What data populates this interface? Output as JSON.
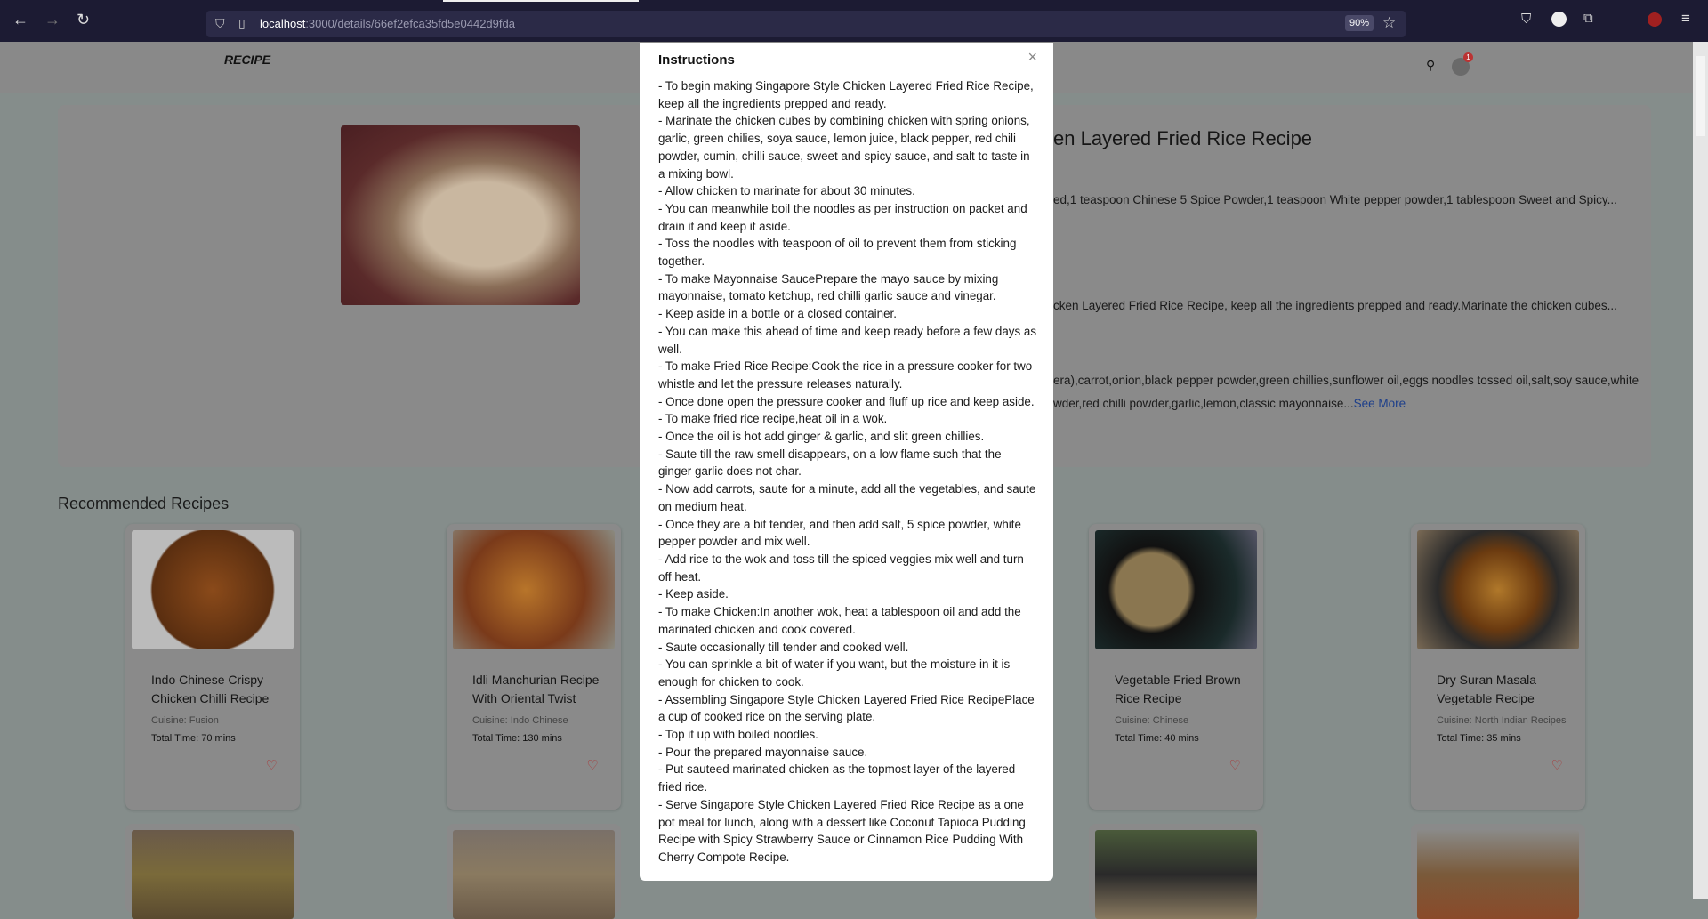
{
  "browser": {
    "url_host": "localhost",
    "url_path": ":3000/details/66ef2efca35fd5e0442d9fda",
    "zoom": "90%",
    "back_icon": "←",
    "forward_icon": "→",
    "reload_icon": "↻"
  },
  "navbar": {
    "logo": "RECIPE",
    "cart_count": "1"
  },
  "recipe": {
    "title_visible": "en Layered Fried Rice Recipe",
    "ingredients_line": "ed,1 teaspoon Chinese 5 Spice Powder,1 teaspoon White pepper powder,1 tablespoon Sweet and Spicy...",
    "instructions_line": "cken Layered Fried Rice Recipe, keep all the ingredients prepped and ready.Marinate the chicken cubes...",
    "other_line1": "era),carrot,onion,black pepper powder,green chillies,sunflower oil,eggs noodles tossed oil,salt,soy sauce,white",
    "other_line2": "wder,red chilli powder,garlic,lemon,classic mayonnaise...",
    "see_more": "See More"
  },
  "recommended": {
    "heading": "Recommended Recipes",
    "cards": [
      {
        "title": "Indo Chinese Crispy Chicken Chilli Recipe",
        "cuisine": "Cuisine: Fusion",
        "time": "Total Time: 70 mins"
      },
      {
        "title": "Idli Manchurian Recipe With Oriental Twist",
        "cuisine": "Cuisine: Indo Chinese",
        "time": "Total Time: 130 mins"
      },
      {
        "title": "Vegetable Fried Brown Rice Recipe",
        "cuisine": "Cuisine: Chinese",
        "time": "Total Time: 40 mins"
      },
      {
        "title": "Dry Suran Masala Vegetable Recipe",
        "cuisine": "Cuisine: North Indian Recipes",
        "time": "Total Time: 35 mins"
      }
    ]
  },
  "modal": {
    "title": "Instructions",
    "close": "×",
    "steps": [
      "- To begin making Singapore Style Chicken Layered Fried Rice Recipe, keep all the ingredients prepped and ready.",
      "- Marinate the chicken cubes by combining chicken with spring onions, garlic, green chilies, soya sauce, lemon juice, black pepper, red chili powder, cumin, chilli sauce, sweet and spicy sauce, and salt to taste in a mixing bowl.",
      "- Allow chicken to marinate for about 30 minutes.",
      "- You can meanwhile boil the noodles as per instruction on packet and drain it and keep it aside.",
      "- Toss the noodles with teaspoon of oil to prevent them from sticking together.",
      "- To make Mayonnaise SaucePrepare the mayo sauce by mixing mayonnaise, tomato ketchup, red chilli garlic sauce and vinegar.",
      "- Keep aside in a bottle or a closed container.",
      "- You can make this ahead of time and keep ready before a few days as well.",
      "- To make Fried Rice Recipe:Cook the rice in a pressure cooker for two whistle and let the pressure releases naturally.",
      "- Once done open the pressure cooker and fluff up rice and keep aside.",
      "- To make fried rice recipe,heat oil in a wok.",
      "- Once the oil is hot add ginger & garlic, and slit green chillies.",
      "- Saute till the raw smell disappears, on a low flame such that the ginger garlic does not char.",
      "- Now add carrots, saute for a minute, add all the vegetables, and saute on medium heat.",
      "- Once they are a bit tender, and then add salt, 5 spice powder, white pepper powder and mix well.",
      "- Add rice to the wok and toss till the spiced veggies mix well and turn off heat.",
      "- Keep aside.",
      "- To make Chicken:In another wok, heat a tablespoon oil and add the marinated chicken and cook covered.",
      "- Saute occasionally till tender and cooked well.",
      "- You can sprinkle a bit of water if you want, but the moisture in it is enough for chicken to cook.",
      "- Assembling Singapore Style Chicken Layered Fried Rice RecipePlace a cup of cooked rice on the serving plate.",
      "- Top it up with boiled noodles.",
      "- Pour the prepared mayonnaise sauce.",
      "- Put sauteed marinated chicken as the topmost layer of the layered fried rice.",
      "- Serve Singapore Style Chicken Layered Fried Rice Recipe as a one pot meal for lunch, along with a dessert like Coconut Tapioca Pudding Recipe with Spicy Strawberry Sauce or Cinnamon Rice Pudding With Cherry Compote Recipe."
    ]
  }
}
